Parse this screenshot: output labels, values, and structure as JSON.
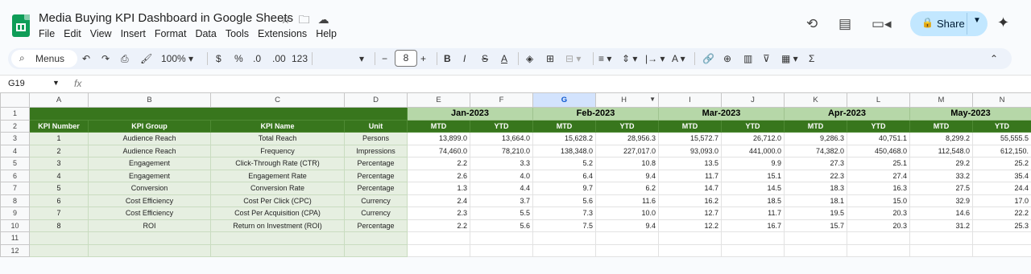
{
  "app": {
    "doc_title": "Media Buying KPI Dashboard in Google Sheets",
    "menu": [
      "File",
      "Edit",
      "View",
      "Insert",
      "Format",
      "Data",
      "Tools",
      "Extensions",
      "Help"
    ],
    "share_label": "Share"
  },
  "toolbar": {
    "menus_label": "Menus",
    "zoom": "100%",
    "currency": "$",
    "percent": "%",
    "dec_decrease": ".0",
    "dec_increase": ".00",
    "number_format": "123",
    "font_size": "8"
  },
  "formula_bar": {
    "cell_ref": "G19",
    "fx": "fx"
  },
  "sheet": {
    "col_letters": [
      "A",
      "B",
      "C",
      "D",
      "E",
      "F",
      "G",
      "H",
      "I",
      "J",
      "K",
      "L",
      "M",
      "N"
    ],
    "months": [
      "Jan-2023",
      "Feb-2023",
      "Mar-2023",
      "Apr-2023",
      "May-2023"
    ],
    "headers": [
      "KPI Number",
      "KPI Group",
      "KPI Name",
      "Unit",
      "MTD",
      "YTD",
      "MTD",
      "YTD",
      "MTD",
      "YTD",
      "MTD",
      "YTD",
      "MTD",
      "YTD"
    ],
    "rows": [
      [
        "1",
        "Audience Reach",
        "Total Reach",
        "Persons",
        "13,899.0",
        "13,664.0",
        "15,628.2",
        "28,956.3",
        "15,572.7",
        "26,712.0",
        "9,286.3",
        "40,751.1",
        "8,299.2",
        "55,555.5"
      ],
      [
        "2",
        "Audience Reach",
        "Frequency",
        "Impressions",
        "74,460.0",
        "78,210.0",
        "138,348.0",
        "227,017.0",
        "93,093.0",
        "441,000.0",
        "74,382.0",
        "450,468.0",
        "112,548.0",
        "612,150."
      ],
      [
        "3",
        "Engagement",
        "Click-Through Rate (CTR)",
        "Percentage",
        "2.2",
        "3.3",
        "5.2",
        "10.8",
        "13.5",
        "9.9",
        "27.3",
        "25.1",
        "29.2",
        "25.2"
      ],
      [
        "4",
        "Engagement",
        "Engagement Rate",
        "Percentage",
        "2.6",
        "4.0",
        "6.4",
        "9.4",
        "11.7",
        "15.1",
        "22.3",
        "27.4",
        "33.2",
        "35.4"
      ],
      [
        "5",
        "Conversion",
        "Conversion Rate",
        "Percentage",
        "1.3",
        "4.4",
        "9.7",
        "6.2",
        "14.7",
        "14.5",
        "18.3",
        "16.3",
        "27.5",
        "24.4"
      ],
      [
        "6",
        "Cost Efficiency",
        "Cost Per Click (CPC)",
        "Currency",
        "2.4",
        "3.7",
        "5.6",
        "11.6",
        "16.2",
        "18.5",
        "18.1",
        "15.0",
        "32.9",
        "17.0"
      ],
      [
        "7",
        "Cost Efficiency",
        "Cost Per Acquisition (CPA)",
        "Currency",
        "2.3",
        "5.5",
        "7.3",
        "10.0",
        "12.7",
        "11.7",
        "19.5",
        "20.3",
        "14.6",
        "22.2"
      ],
      [
        "8",
        "ROI",
        "Return on Investment (ROI)",
        "Percentage",
        "2.2",
        "5.6",
        "7.5",
        "9.4",
        "12.2",
        "16.7",
        "15.7",
        "20.3",
        "31.2",
        "25.3"
      ]
    ],
    "row_numbers": [
      "1",
      "2",
      "3",
      "4",
      "5",
      "6",
      "7",
      "8",
      "9",
      "10",
      "11",
      "12"
    ]
  }
}
